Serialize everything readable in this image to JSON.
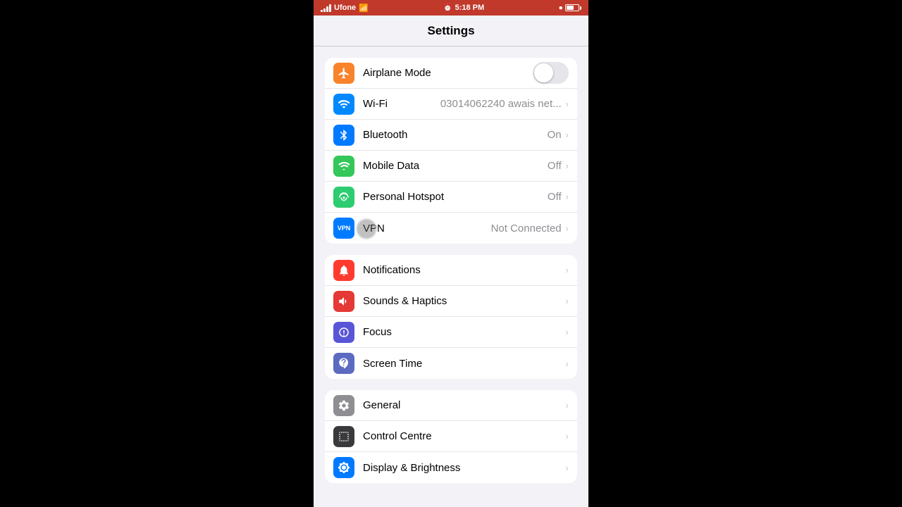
{
  "statusBar": {
    "carrier": "Ufone",
    "time": "5:18 PM",
    "wifi": "wifi",
    "battery": "battery"
  },
  "navBar": {
    "title": "Settings"
  },
  "groups": [
    {
      "id": "connectivity",
      "rows": [
        {
          "id": "airplane-mode",
          "label": "Airplane Mode",
          "iconBg": "bg-orange",
          "icon": "airplane",
          "value": "",
          "hasToggle": true,
          "toggleOn": false,
          "hasChevron": false
        },
        {
          "id": "wifi",
          "label": "Wi-Fi",
          "iconBg": "bg-blue2",
          "icon": "wifi",
          "value": "03014062240 awais net...",
          "hasToggle": false,
          "hasChevron": true
        },
        {
          "id": "bluetooth",
          "label": "Bluetooth",
          "iconBg": "bg-blue",
          "icon": "bluetooth",
          "value": "On",
          "hasToggle": false,
          "hasChevron": true
        },
        {
          "id": "mobile-data",
          "label": "Mobile Data",
          "iconBg": "bg-green",
          "icon": "mobile-data",
          "value": "Off",
          "hasToggle": false,
          "hasChevron": true
        },
        {
          "id": "personal-hotspot",
          "label": "Personal Hotspot",
          "iconBg": "bg-green2",
          "icon": "hotspot",
          "value": "Off",
          "hasToggle": false,
          "hasChevron": true
        },
        {
          "id": "vpn",
          "label": "VPN",
          "iconBg": "bg-blue3",
          "icon": "vpn",
          "value": "Not Connected",
          "hasToggle": false,
          "hasChevron": true
        }
      ]
    },
    {
      "id": "notifications-group",
      "rows": [
        {
          "id": "notifications",
          "label": "Notifications",
          "iconBg": "bg-red2",
          "icon": "notifications",
          "value": "",
          "hasToggle": false,
          "hasChevron": true
        },
        {
          "id": "sounds-haptics",
          "label": "Sounds & Haptics",
          "iconBg": "bg-red",
          "icon": "sounds",
          "value": "",
          "hasToggle": false,
          "hasChevron": true
        },
        {
          "id": "focus",
          "label": "Focus",
          "iconBg": "bg-purple",
          "icon": "focus",
          "value": "",
          "hasToggle": false,
          "hasChevron": true
        },
        {
          "id": "screen-time",
          "label": "Screen Time",
          "iconBg": "bg-indigo",
          "icon": "screen-time",
          "value": "",
          "hasToggle": false,
          "hasChevron": true
        }
      ]
    },
    {
      "id": "general-group",
      "rows": [
        {
          "id": "general",
          "label": "General",
          "iconBg": "bg-gray",
          "icon": "general",
          "value": "",
          "hasToggle": false,
          "hasChevron": true
        },
        {
          "id": "control-centre",
          "label": "Control Centre",
          "iconBg": "bg-dark",
          "icon": "control-centre",
          "value": "",
          "hasToggle": false,
          "hasChevron": true
        },
        {
          "id": "display-brightness",
          "label": "Display & Brightness",
          "iconBg": "bg-blue",
          "icon": "display",
          "value": "",
          "hasToggle": false,
          "hasChevron": true
        }
      ]
    }
  ]
}
